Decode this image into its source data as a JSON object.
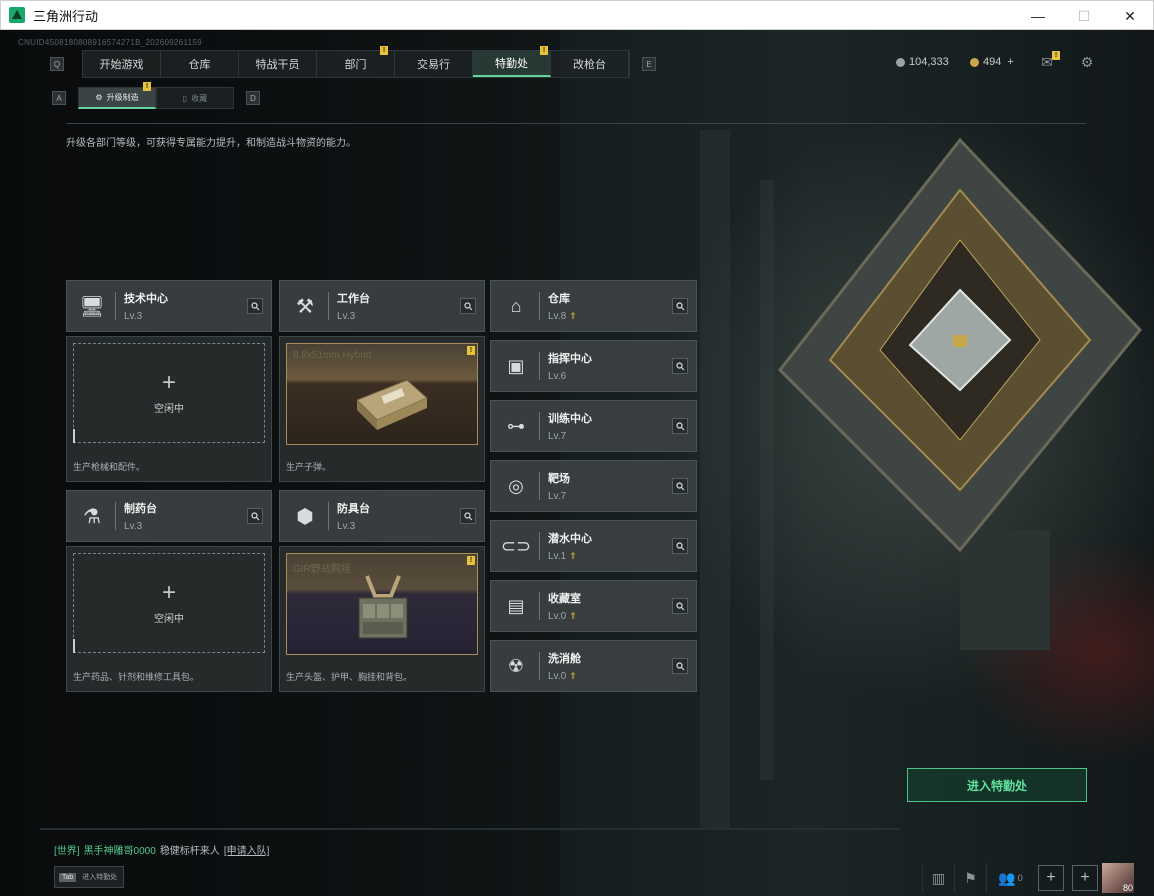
{
  "window": {
    "title": "三角洲行动",
    "controls": {
      "minimize": "—",
      "maximize": "☐",
      "close": "✕"
    }
  },
  "build_id": "CNUID4508180808916574271B_202609261159",
  "top_nav": {
    "left_key": "Q",
    "right_key": "E",
    "tabs": [
      {
        "label": "开始游戏",
        "active": false,
        "badge": ""
      },
      {
        "label": "仓库",
        "active": false,
        "badge": ""
      },
      {
        "label": "特战干员",
        "active": false,
        "badge": ""
      },
      {
        "label": "部门",
        "active": false,
        "badge": "!"
      },
      {
        "label": "交易行",
        "active": false,
        "badge": ""
      },
      {
        "label": "特勤处",
        "active": true,
        "badge": "!"
      },
      {
        "label": "改枪台",
        "active": false,
        "badge": ""
      }
    ]
  },
  "currency": {
    "coins": "104,333",
    "tickets": "494",
    "tickets_plus": "+"
  },
  "top_icons": {
    "mail_icon": "mail-icon",
    "mail_badge": "!",
    "settings_icon": "gear-icon"
  },
  "sub_nav": {
    "left_key": "A",
    "right_key": "D",
    "tabs": [
      {
        "label": "升级制造",
        "active": true,
        "badge": "!"
      },
      {
        "label": "收藏",
        "active": false,
        "badge": ""
      }
    ]
  },
  "page_desc": "升级各部门等级，可获得专属能力提升，和制造战斗物资的能力。",
  "workshops": [
    {
      "name": "技术中心",
      "level": "Lv.3",
      "status": "空闲中",
      "status_plus": "+",
      "desc": "生产枪械和配件。",
      "product": ""
    },
    {
      "name": "工作台",
      "level": "Lv.3",
      "status": "",
      "desc": "生产子弹。",
      "product": "8.8x51mm Hybrid",
      "badge": "!"
    },
    {
      "name": "制药台",
      "level": "Lv.3",
      "status": "空闲中",
      "status_plus": "+",
      "desc": "生产药品、针剂和维修工具包。",
      "product": ""
    },
    {
      "name": "防具台",
      "level": "Lv.3",
      "status": "",
      "desc": "生产头盔、护甲、胸挂和背包。",
      "product": "GIR野战胸挂",
      "badge": "!"
    }
  ],
  "facilities": [
    {
      "name": "仓库",
      "level": "Lv.8",
      "upgradable": true
    },
    {
      "name": "指挥中心",
      "level": "Lv.6",
      "upgradable": false
    },
    {
      "name": "训练中心",
      "level": "Lv.7",
      "upgradable": false
    },
    {
      "name": "靶场",
      "level": "Lv.7",
      "upgradable": false
    },
    {
      "name": "潜水中心",
      "level": "Lv.1",
      "upgradable": true
    },
    {
      "name": "收藏室",
      "level": "Lv.0",
      "upgradable": true
    },
    {
      "name": "洗消舱",
      "level": "Lv.0",
      "upgradable": true
    }
  ],
  "enter_button": "进入特勤处",
  "chat": {
    "channel": "[世界]",
    "user": "黑手神雕哥0000",
    "message": "稳健标杆来人",
    "link": "[申请入队]"
  },
  "tab_hint": {
    "key": "Tab",
    "label": "进入特勤处"
  },
  "bottom_bar": {
    "friends_count": "0",
    "avatar_level": "80",
    "plus": "+"
  },
  "colors": {
    "accent": "#5fd39a",
    "badge": "#e8c23a",
    "card": "#3a3f41"
  }
}
